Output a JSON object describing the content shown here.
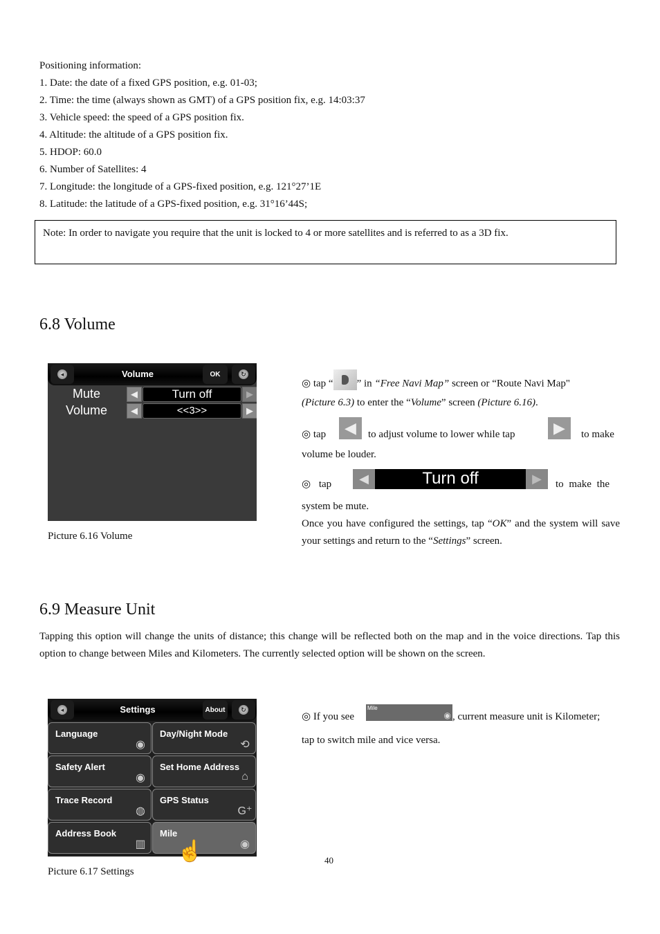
{
  "positioning": {
    "heading": "Positioning information:",
    "items": [
      "1. Date: the date of a fixed GPS position, e.g. 01-03;",
      "2. Time: the time (always shown as GMT) of a GPS position fix, e.g. 14:03:37",
      "3. Vehicle speed: the speed of a GPS position fix.",
      "4. Altitude: the altitude of a GPS position fix.",
      "5. HDOP: 60.0",
      "6. Number of Satellites: 4",
      "7. Longitude: the longitude of a GPS-fixed position, e.g. 121°27’1E",
      "8. Latitude: the latitude of a GPS-fixed position, e.g. 31°16’44S;"
    ],
    "note": "Note: In order to navigate you require that the unit is locked to 4 or more satellites and is referred to as a 3D fix."
  },
  "volume_section": {
    "title": "6.8 Volume",
    "screen": {
      "title": "Volume",
      "ok_label": "OK",
      "rows": [
        {
          "label": "Mute",
          "value": "Turn off"
        },
        {
          "label": "Volume",
          "value": "<<3>>"
        }
      ]
    },
    "caption": "Picture 6.16 Volume",
    "instructions": {
      "p1_prefix": "◎  tap “",
      "p1_mid": "” in ",
      "p1_free": "“Free Navi Map”",
      "p1_rest": " screen or “Route Navi Map\"",
      "p1_pic": "(Picture 6.3)",
      "p1_to": " to enter the “",
      "p1_vol": "Volume",
      "p1_screen": "” screen ",
      "p1_pic2": "(Picture 6.16)",
      "p1_end": ".",
      "p2_a": "◎  tap",
      "p2_b": "to adjust volume to lower while tap",
      "p2_c": "to make",
      "p2_d": "volume be louder.",
      "p3_a": "◎     tap",
      "p3_widget": "Turn off",
      "p3_b": "to   make   the",
      "p3_c": "system be mute.",
      "p4_a": "Once you have configured the settings, tap “",
      "p4_ok": "OK",
      "p4_b": "” and the system will save your settings and return to the “",
      "p4_settings": "Settings",
      "p4_c": "” screen."
    }
  },
  "measure_section": {
    "title": "6.9 Measure Unit",
    "description": "Tapping this option will change the units of distance; this change will be reflected both on the map and in the voice directions. Tap this option to change between Miles and Kilometers. The currently selected option will be shown on the screen.",
    "screen": {
      "title": "Settings",
      "about_label": "About",
      "tiles": [
        {
          "label": "Language",
          "icon": "language-icon"
        },
        {
          "label": "Day/Night Mode",
          "icon": "day-night-icon"
        },
        {
          "label": "Safety Alert",
          "icon": "safety-alert-icon"
        },
        {
          "label": "Set Home Address",
          "icon": "home-icon"
        },
        {
          "label": "Trace Record",
          "icon": "trace-record-icon"
        },
        {
          "label": "GPS Status",
          "icon": "gps-status-icon"
        },
        {
          "label": "Address Book",
          "icon": "address-book-icon"
        },
        {
          "label": "Mile",
          "icon": "measure-unit-icon"
        }
      ]
    },
    "caption": "Picture 6.17 Settings",
    "instructions": {
      "a": "◎  If you see",
      "widget_label": "Mile",
      "b": ", current measure unit is Kilometer;",
      "c": "tap to switch mile and vice versa."
    }
  },
  "page_number": "40"
}
